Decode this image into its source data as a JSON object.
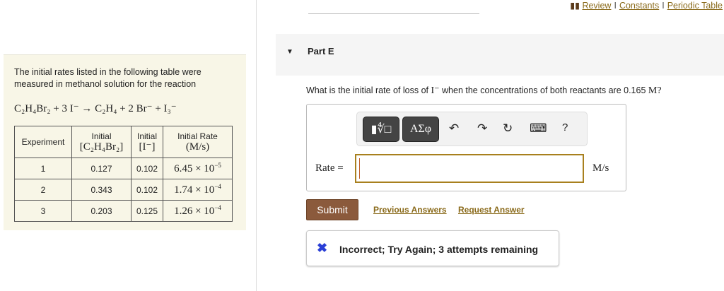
{
  "header": {
    "links": [
      {
        "label": "Review",
        "icon": "book-icon"
      },
      {
        "label": "Constants"
      },
      {
        "label": "Periodic Table"
      }
    ],
    "separator": "I"
  },
  "left": {
    "intro": "The initial rates listed in the following table were measured in methanol solution for the reaction",
    "reaction": "C₂H₄Br₂ + 3 I⁻ → C₂H₄ + 2 Br⁻ + I₃⁻",
    "table": {
      "headers": [
        {
          "line1": "Experiment",
          "line2": ""
        },
        {
          "line1": "Initial",
          "line2": "[C₂H₄Br₂]"
        },
        {
          "line1": "Initial",
          "line2": "[I⁻]"
        },
        {
          "line1": "Initial Rate",
          "line2": "(M/s)"
        }
      ],
      "rows": [
        {
          "exp": "1",
          "c2h4br2": "0.127",
          "iodide": "0.102",
          "rate_mant": "6.45 × 10",
          "rate_exp": "−5"
        },
        {
          "exp": "2",
          "c2h4br2": "0.343",
          "iodide": "0.102",
          "rate_mant": "1.74 × 10",
          "rate_exp": "−4"
        },
        {
          "exp": "3",
          "c2h4br2": "0.203",
          "iodide": "0.125",
          "rate_mant": "1.26 × 10",
          "rate_exp": "−4"
        }
      ]
    }
  },
  "part": {
    "label": "Part E",
    "question_pre": "What is the initial rate of loss of",
    "question_species": "I⁻",
    "question_post": "when the concentrations of both reactants are 0.165",
    "question_unit": "M?"
  },
  "toolbar": {
    "templates_label": "▮∜□",
    "greek_label": "ΑΣφ",
    "undo": "↶",
    "redo": "↷",
    "reset": "↻",
    "keyboard": "⌨",
    "help": "?"
  },
  "answer": {
    "label": "Rate =",
    "value": "",
    "units": "M/s"
  },
  "actions": {
    "submit": "Submit",
    "previous": "Previous Answers",
    "request": "Request Answer"
  },
  "feedback": {
    "icon": "✖",
    "text": "Incorrect; Try Again; 3 attempts remaining",
    "icon_color": "#2a3fd6"
  },
  "colors": {
    "accent": "#8a6a1a",
    "submit": "#8b5a3c",
    "panel": "#f8f6e7"
  }
}
